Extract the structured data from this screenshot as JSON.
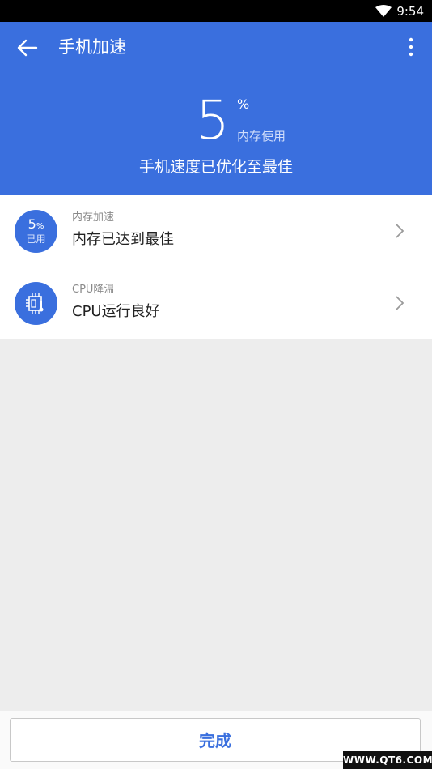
{
  "status_bar": {
    "time": "9:54",
    "wifi_icon": "wifi-icon"
  },
  "header": {
    "title": "手机加速",
    "memory_percent": "5",
    "percent_sign": "%",
    "memory_label": "内存使用",
    "status": "手机速度已优化至最佳",
    "color": "#3a6fde"
  },
  "items": [
    {
      "icon_value": "5",
      "icon_unit": "%",
      "icon_caption": "已用",
      "label": "内存加速",
      "value": "内存已达到最佳"
    },
    {
      "icon": "cpu-thermometer-icon",
      "label": "CPU降温",
      "value": "CPU运行良好"
    }
  ],
  "done_button": {
    "label": "完成"
  },
  "watermark": {
    "text": "WWW.QT6.COM"
  }
}
